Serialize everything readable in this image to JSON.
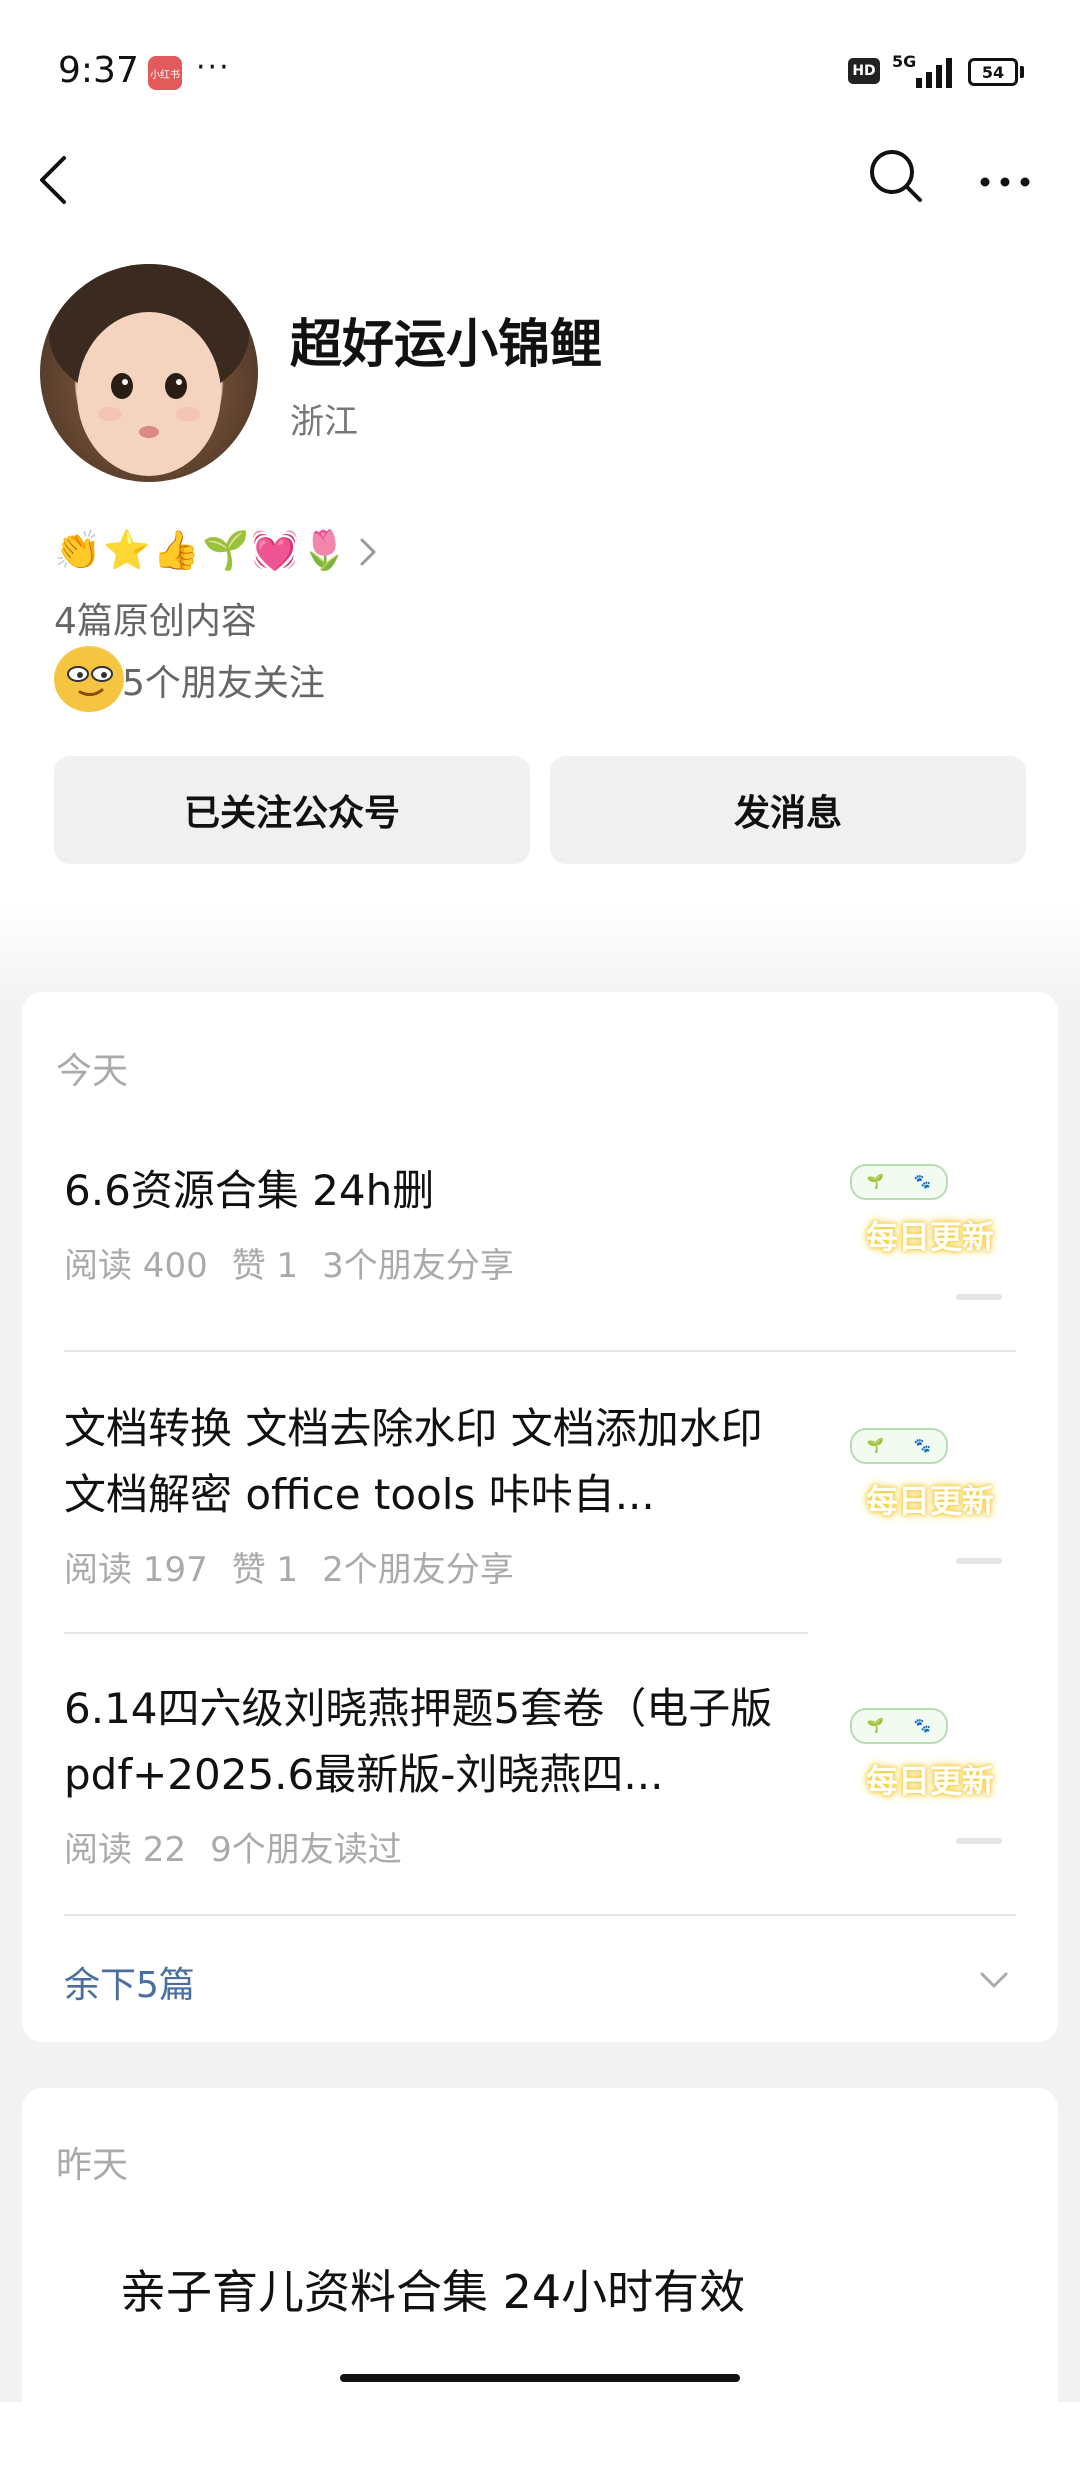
{
  "status_bar": {
    "time": "9:37",
    "app_badge_text": "小红书",
    "overflow": "···",
    "hd": "HD",
    "network": "5G",
    "battery": "54"
  },
  "nav": {
    "back_icon": "chevron-left-icon",
    "search_icon": "search-icon",
    "more_icon": "more-horizontal-icon"
  },
  "profile": {
    "name": "超好运小锦鲤",
    "location": "浙江",
    "emoji_badges": "👏⭐👍🌱💓🌷",
    "original_count": "4篇原创内容",
    "friends_follow": "5个朋友关注"
  },
  "actions": {
    "follow_label": "已关注公众号",
    "message_label": "发消息"
  },
  "today": {
    "label": "今天",
    "articles": [
      {
        "title": "6.6资源合集 24h删",
        "reads": "阅读 400",
        "likes": "赞 1",
        "shares": "3个朋友分享"
      },
      {
        "title": "文档转换  文档去除水印 文档添加水印  文档解密  office  tools 咔咔自...",
        "reads": "阅读 197",
        "likes": "赞 1",
        "shares": "2个朋友分享"
      },
      {
        "title": "6.14四六级刘晓燕押题5套卷（电子版pdf+2025.6最新版-刘晓燕四...",
        "reads": "阅读 22",
        "likes": "",
        "shares": "9个朋友读过"
      }
    ],
    "more_label": "余下5篇",
    "thumb_text": "每日更新"
  },
  "yesterday": {
    "label": "昨天",
    "article_title": "亲子育儿资料合集  24小时有效"
  }
}
